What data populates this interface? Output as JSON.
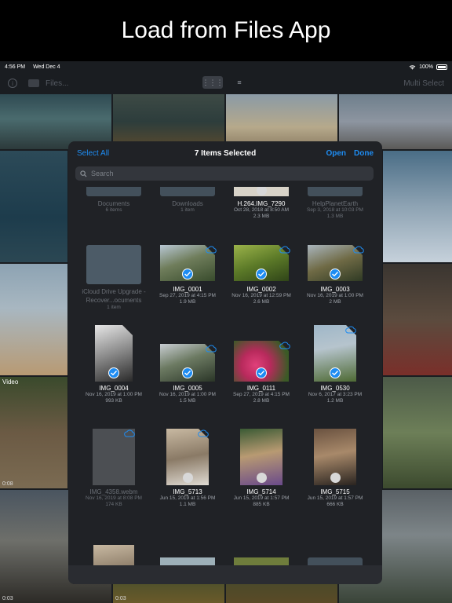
{
  "caption": "Load from Files App",
  "status": {
    "time": "4:56 PM",
    "date": "Wed Dec 4",
    "battery": "100%"
  },
  "appbar": {
    "files_label": "Files...",
    "multi_select": "Multi Select",
    "info_glyph": "i",
    "grid_glyph": "⋮⋮⋮",
    "list_glyph": "≡"
  },
  "bg_labels": {
    "video": "Video",
    "dur1": "0:08",
    "dur2": "0:03",
    "dur3": "0:03"
  },
  "modal": {
    "select_all": "Select All",
    "title": "7 Items Selected",
    "open": "Open",
    "done": "Done",
    "search_placeholder": "Search"
  },
  "items": [
    {
      "name": "Documents",
      "meta1": "6 items",
      "meta2": ""
    },
    {
      "name": "Downloads",
      "meta1": "1 item",
      "meta2": ""
    },
    {
      "name": "H.264.IMG_7290",
      "meta1": "Oct 28, 2018 at 8:50 AM",
      "meta2": "2.3 MB"
    },
    {
      "name": "HelpPlanetEarth",
      "meta1": "Sep 3, 2018 at 10:03 PM",
      "meta2": "1.3 MB"
    },
    {
      "name": "iCloud Drive Upgrade - Recover...ocuments",
      "meta1": "1 item",
      "meta2": ""
    },
    {
      "name": "IMG_0001",
      "meta1": "Sep 27, 2019 at 4:15 PM",
      "meta2": "1.9 MB"
    },
    {
      "name": "IMG_0002",
      "meta1": "Nov 16, 2019 at 12:59 PM",
      "meta2": "2.6 MB"
    },
    {
      "name": "IMG_0003",
      "meta1": "Nov 16, 2019 at 1:00 PM",
      "meta2": "2 MB"
    },
    {
      "name": "IMG_0004",
      "meta1": "Nov 16, 2019 at 1:00 PM",
      "meta2": "993 KB"
    },
    {
      "name": "IMG_0005",
      "meta1": "Nov 16, 2019 at 1:00 PM",
      "meta2": "1.5 MB"
    },
    {
      "name": "IMG_0111",
      "meta1": "Sep 27, 2019 at 4:15 PM",
      "meta2": "2.8 MB"
    },
    {
      "name": "IMG_0530",
      "meta1": "Nov 6, 2017 at 3:23 PM",
      "meta2": "1.2 MB"
    },
    {
      "name": "IMG_4358.webm",
      "meta1": "Nov 16, 2019 at 8:08 PM",
      "meta2": "174 KB"
    },
    {
      "name": "IMG_5713",
      "meta1": "Jun 15, 2019 at 1:56 PM",
      "meta2": "1.1 MB"
    },
    {
      "name": "IMG_5714",
      "meta1": "Jun 15, 2019 at 1:57 PM",
      "meta2": "885 KB"
    },
    {
      "name": "IMG_5715",
      "meta1": "Jun 15, 2019 at 1:57 PM",
      "meta2": "666 KB"
    }
  ],
  "colors": {
    "accent": "#1e8cf2",
    "modal_bg": "#202226",
    "folder": "#5b6f7e"
  }
}
